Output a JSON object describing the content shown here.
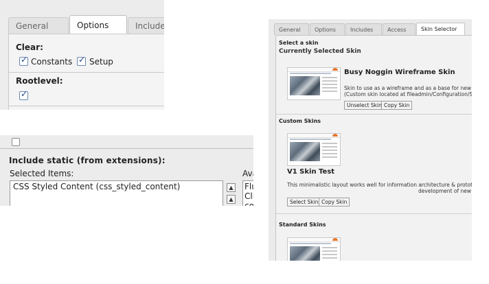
{
  "options_panel": {
    "tabs": [
      "General",
      "Options",
      "Include"
    ],
    "active_tab": "Options",
    "clear_label": "Clear:",
    "constants_label": "Constants",
    "constants_checked": true,
    "setup_label": "Setup",
    "setup_checked": true,
    "rootlevel_label": "Rootlevel:",
    "rootlevel_checked": true
  },
  "include_panel": {
    "title": "Include static (from extensions):",
    "selected_label": "Selected Items:",
    "available_label": "Ava",
    "selected_items": [
      "CSS Styled Content (css_styled_content)"
    ],
    "available_items": [
      "Flu",
      "Cli",
      "co"
    ]
  },
  "skin_panel": {
    "tabs": [
      "General",
      "Options",
      "Includes",
      "Access",
      "Skin Selector"
    ],
    "active_tab": "Skin Selector",
    "select_label": "Select a skin",
    "current_heading": "Currently Selected Skin",
    "current_skin": {
      "name": "Busy Noggin Wireframe Skin",
      "desc_line1": "Skin to use as a wireframe and as a base for new skin",
      "desc_line2": "(Custom skin located at fileadmin/Configuration/Site/S",
      "unselect_label": "Unselect Skin",
      "copy_label": "Copy Skin"
    },
    "custom_heading": "Custom Skins",
    "custom_skin": {
      "name": "V1 Skin Test",
      "desc_line1": "This minimalistic layout works well for information architecture & prototyping.",
      "desc_line2": "development of new skins.",
      "select_label": "Select Skin",
      "copy_label": "Copy Skin"
    },
    "standard_heading": "Standard Skins"
  }
}
